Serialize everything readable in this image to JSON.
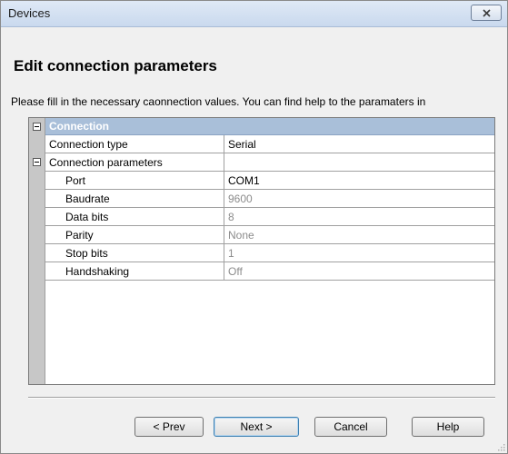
{
  "window": {
    "title": "Devices"
  },
  "page": {
    "heading": "Edit connection parameters",
    "instructions": "Please fill in the necessary caonnection values. You can find help to the paramaters in"
  },
  "grid": {
    "category": "Connection",
    "connection_type": {
      "name": "Connection type",
      "value": "Serial"
    },
    "connection_parameters": {
      "name": "Connection parameters",
      "value": ""
    },
    "params": [
      {
        "name": "Port",
        "value": "COM1"
      },
      {
        "name": "Baudrate",
        "value": "9600"
      },
      {
        "name": "Data bits",
        "value": "8"
      },
      {
        "name": "Parity",
        "value": "None"
      },
      {
        "name": "Stop bits",
        "value": "1"
      },
      {
        "name": "Handshaking",
        "value": "Off"
      }
    ]
  },
  "buttons": {
    "prev": "< Prev",
    "next": "Next >",
    "cancel": "Cancel",
    "help": "Help"
  },
  "icons": {
    "close": "close-icon",
    "collapse": "minus-box-icon",
    "resize": "resize-grip-icon"
  },
  "colors": {
    "category_header": "#a9bfd9",
    "grid_gutter": "#c7c7c7",
    "readonly_value": "#8c8c8c"
  }
}
